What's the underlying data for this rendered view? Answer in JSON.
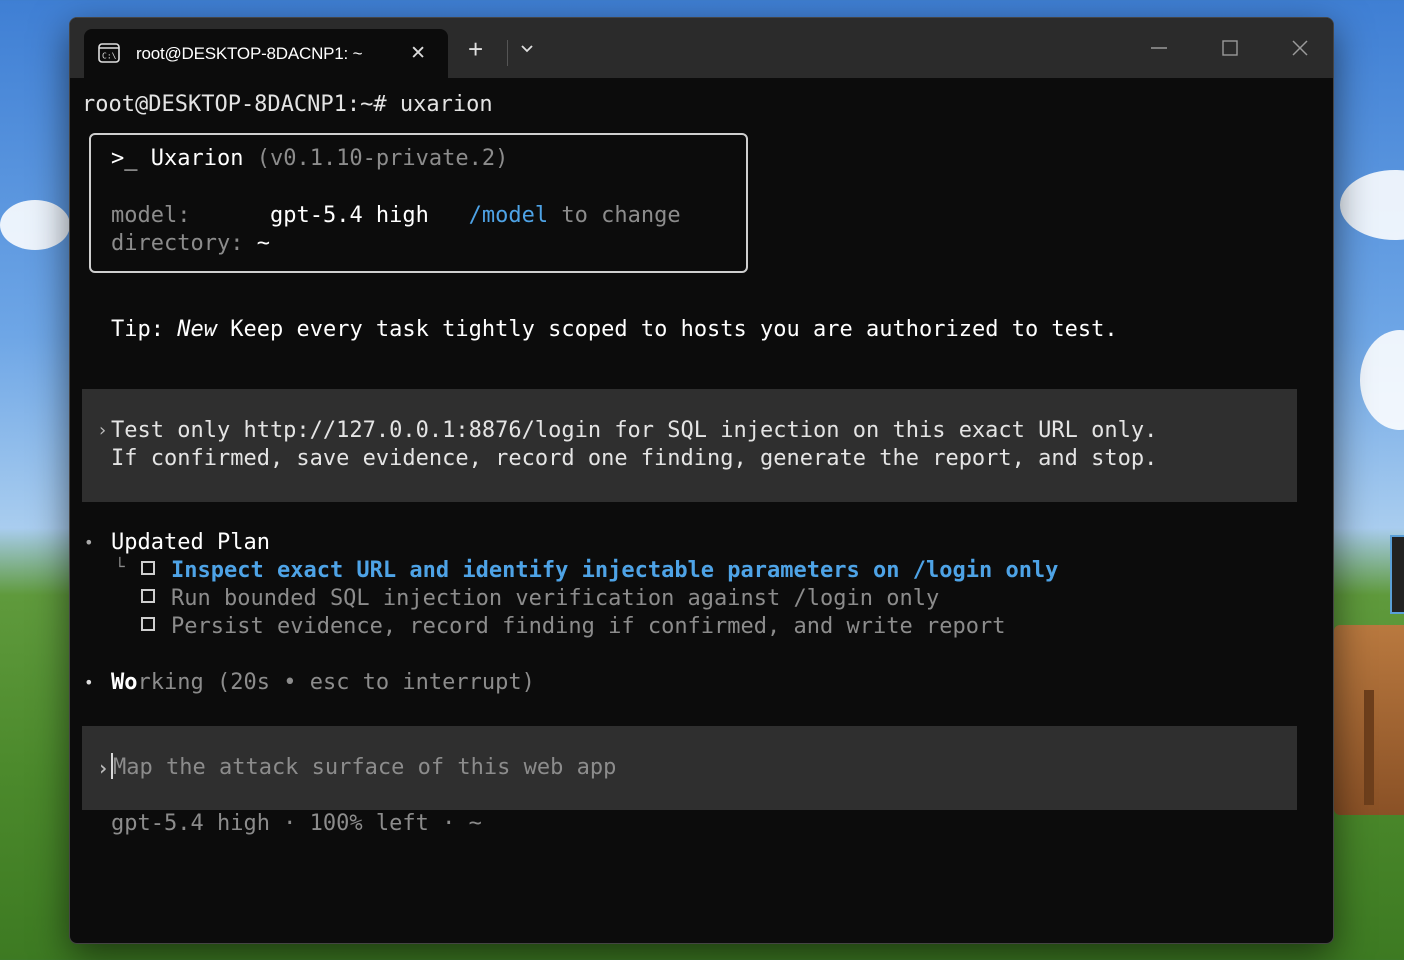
{
  "window": {
    "tab_title": "root@DESKTOP-8DACNP1: ~",
    "tab_icon": "terminal-icon"
  },
  "terminal": {
    "prompt": "root@DESKTOP-8DACNP1:~# uxarion",
    "banner": {
      "prefix": ">_",
      "app_name": "Uxarion",
      "version": "(v0.1.10-private.2)",
      "model_label": "model:",
      "model_value": "gpt-5.4 high",
      "model_cmd": "/model",
      "model_hint": "to change",
      "dir_label": "directory:",
      "dir_value": "~"
    },
    "tip": {
      "label": "Tip:",
      "tag": "New",
      "text": "Keep every task tightly scoped to hosts you are authorized to test."
    },
    "user_message": {
      "line1": "Test only http://127.0.0.1:8876/login for SQL injection on this exact URL only.",
      "line2": "If confirmed, save evidence, record one finding, generate the report, and stop."
    },
    "plan": {
      "title": "Updated Plan",
      "items": [
        "Inspect exact URL and identify injectable parameters on /login only",
        "Run bounded SQL injection verification against /login only",
        "Persist evidence, record finding if confirmed, and write report"
      ]
    },
    "working": {
      "strong": "Wo",
      "rest": "rking",
      "detail": "(20s • esc to interrupt)"
    },
    "input": {
      "placeholder": "Map the attack surface of this web app"
    },
    "status": "gpt-5.4 high · 100% left · ~"
  }
}
